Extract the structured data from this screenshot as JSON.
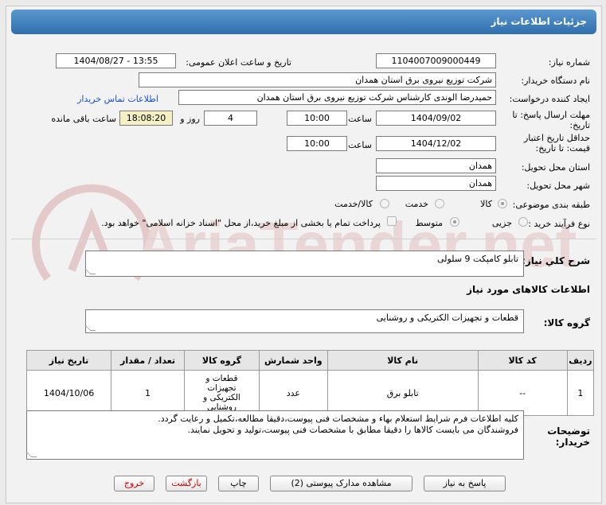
{
  "header": {
    "title": "جزئیات اطلاعات نیاز"
  },
  "fields": {
    "need_number_label": "شماره نیاز:",
    "need_number": "1104007009000449",
    "announce_label": "تاریخ و ساعت اعلان عمومی:",
    "announce_value": "1404/08/27 - 13:55",
    "buyer_org_label": "نام دستگاه خریدار:",
    "buyer_org": "شرکت توزیع نیروی برق استان همدان",
    "requester_label": "ایجاد کننده درخواست:",
    "requester": "حمیدرضا الوندی کارشناس شرکت توزیع نیروی برق استان همدان",
    "contact_link": "اطلاعات تماس خریدار",
    "deadline_label_1": "مهلت ارسال پاسخ: تا",
    "deadline_label_2": "تاریخ:",
    "deadline_date": "1404/09/02",
    "time_label": "ساعت",
    "deadline_time": "10:00",
    "days_value": "4",
    "days_label": "روز و",
    "remaining_time": "18:08:20",
    "remaining_label": "ساعت باقی مانده",
    "validity_label_1": "حداقل تاریخ اعتبار",
    "validity_label_2": "قیمت: تا تاریخ:",
    "validity_date": "1404/12/02",
    "validity_time_label": "ساعت",
    "validity_time": "10:00",
    "province_label": "استان محل تحویل:",
    "province": "همدان",
    "city_label": "شهر محل تحویل:",
    "city": "همدان",
    "category_label": "طبقه بندی موضوعی:",
    "category_options": [
      "کالا",
      "خدمت",
      "کالا/خدمت"
    ],
    "process_label": "نوع فرآیند خرید :",
    "process_options": [
      "جزیی",
      "متوسط"
    ],
    "payment_note": "پرداخت تمام یا بخشی از مبلغ خرید،از محل \"اسناد خزانه اسلامی\" خواهد بود."
  },
  "description": {
    "label": "شرح کلي نياز:",
    "value": "تابلو کامپکت 9 سلولی"
  },
  "goods_info_title": "اطلاعات کالاهای مورد نیاز",
  "goods_group": {
    "label": "گروه کالا:",
    "value": "قطعات و تجهیزات الکتریکی و روشنایی"
  },
  "table": {
    "headers": [
      "ردیف",
      "کد کالا",
      "نام کالا",
      "واحد شمارش",
      "گروه کالا",
      "تعداد / مقدار",
      "تاریخ نیاز"
    ],
    "rows": [
      {
        "row": "1",
        "code": "--",
        "name": "تابلو برق",
        "unit": "عدد",
        "group": "قطعات و تجهیزات الکتریکی و روشنایی",
        "qty": "1",
        "date": "1404/10/06"
      }
    ]
  },
  "buyer_notes": {
    "label_1": "توضیحات",
    "label_2": "خریدار:",
    "line_1": "کلیه اطلاعات فرم شرایط استعلام بهاء و مشخصات فنی پیوست،دقیقا مطالعه،تکمیل و رعایت گردد.",
    "line_2": "فروشندگان می بایست کالاها را دقیقا مطابق با مشخصات فنی پیوست،تولید و تحویل نمایند."
  },
  "buttons": {
    "respond": "پاسخ به نیاز",
    "docs": "مشاهده مدارک پیوستی (2)",
    "print": "چاپ",
    "back": "بازگشت",
    "exit": "خروج"
  },
  "watermark": "AriaTender.net",
  "colors": {
    "header": "#3c7dbd",
    "link": "#1a4fd0",
    "remaining_bg": "#f5efc4",
    "exit": "#cc0000"
  }
}
